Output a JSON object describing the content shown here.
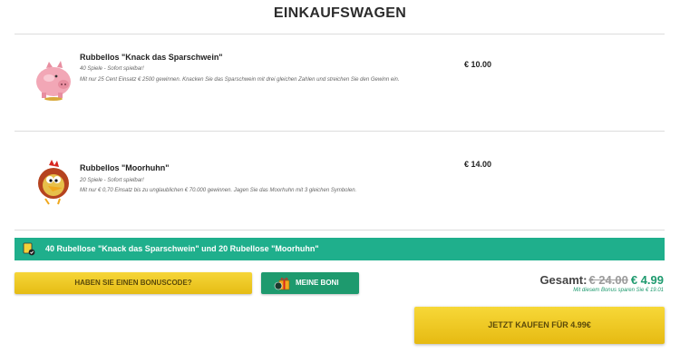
{
  "header": {
    "title": "EINKAUFSWAGEN"
  },
  "cart": {
    "items": [
      {
        "name": "Rubbellos \"Knack das Sparschwein\"",
        "subtitle": "40 Spiele - Sofort spielbar!",
        "description": "Mit nur 25 Cent Einsatz € 2500 gewinnen. Knacken Sie das Sparschwein mit drei gleichen Zahlen und streichen Sie den Gewinn ein.",
        "price": "€ 10.00",
        "icon": "piggy-bank-icon"
      },
      {
        "name": "Rubbellos \"Moorhuhn\"",
        "subtitle": "20 Spiele - Sofort spielbar!",
        "description": "Mit nur € 0,70 Einsatz bis zu unglaublichen € 70.000 gewinnen. Jagen Sie das Moorhuhn mit 3 gleichen Symbolen.",
        "price": "€ 14.00",
        "icon": "moorhuhn-chicken-icon"
      }
    ]
  },
  "summary_bar": {
    "text": "40 Rubellose \"Knack das Sparschwein\" und 20 Rubellose \"Moorhuhn\""
  },
  "actions": {
    "bonus_code_label": "HABEN SIE EINEN BONUSCODE?",
    "my_boni_label": "MEINE BONI",
    "buy_label": "JETZT KAUFEN FÜR 4.99€"
  },
  "totals": {
    "label": "Gesamt:",
    "old_price": "€ 24.00",
    "new_price": "€ 4.99",
    "savings_text": "Mit diesem Bonus sparen Sie € 19.01"
  },
  "colors": {
    "accent_green": "#1faf8c",
    "button_yellow": "#f2cc2a",
    "price_green": "#1e9a6e"
  }
}
